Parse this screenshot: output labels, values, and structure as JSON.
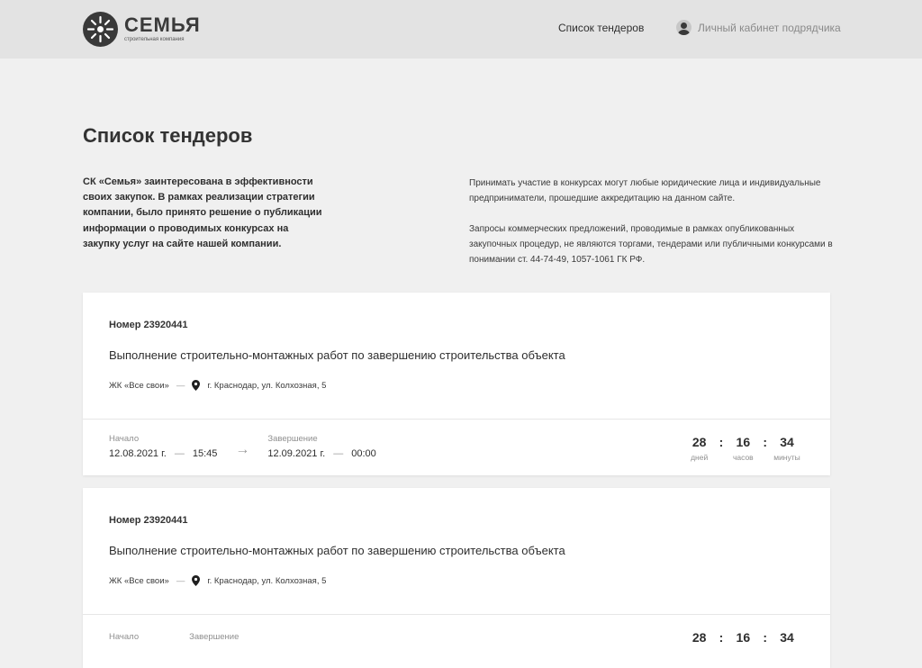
{
  "header": {
    "logo_name": "СЕМЬЯ",
    "logo_subtitle": "строительная компания",
    "nav_tenders": "Список тендеров",
    "nav_cabinet": "Личный кабинет подрядчика"
  },
  "page_title": "Список тендеров",
  "intro_left": "СК «Семья» заинтересована в эффективности своих закупок. В рамках реализации стратегии компании, было принято решение о публикации информации о проводимых конкурсах на закупку услуг на сайте нашей компании.",
  "intro_right": [
    "Принимать участие в конкурсах могут любые юридические лица и индивидуальные предприниматели, прошедшие аккредитацию на данном сайте.",
    "Запросы коммерческих предложений, проводимые в рамках опубликованных закупочных процедур, не являются торгами, тендерами или публичными конкурсами в понимании ст. 44-74-49, 1057-1061 ГК РФ."
  ],
  "tenders": [
    {
      "number": "Номер 23920441",
      "title": "Выполнение строительно-монтажных работ по завершению строительства объекта",
      "complex": "ЖК «Все свои»",
      "address": "г. Краснодар, ул. Колхозная, 5",
      "start_label": "Начало",
      "start_date": "12.08.2021 г.",
      "start_time": "15:45",
      "end_label": "Завершение",
      "end_date": "12.09.2021 г.",
      "end_time": "00:00",
      "countdown": {
        "days": "28",
        "days_label": "дней",
        "hours": "16",
        "hours_label": "часов",
        "minutes": "34",
        "minutes_label": "минуты"
      }
    },
    {
      "number": "Номер 23920441",
      "title": "Выполнение строительно-монтажных работ по завершению строительства объекта",
      "complex": "ЖК «Все свои»",
      "address": "г. Краснодар, ул. Колхозная, 5",
      "start_label": "Начало",
      "end_label": "Завершение",
      "countdown": {
        "days": "28",
        "hours": "16",
        "minutes": "34"
      }
    }
  ],
  "icons": {
    "logo": "sun-logo-icon",
    "avatar": "user-avatar-icon",
    "location": "map-pin-icon",
    "arrow": "arrow-right-icon"
  },
  "colors": {
    "header_bg": "#e3e3e3",
    "page_bg": "#f0f0f0",
    "card_bg": "#ffffff",
    "text": "#2e2e2e",
    "muted": "#8f8f8f"
  }
}
